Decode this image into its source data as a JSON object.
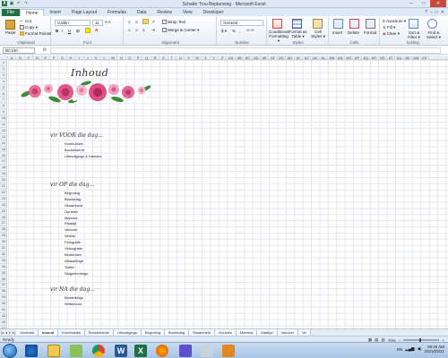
{
  "window": {
    "title": "Schatte Trou Beplanning  -  Microsoft Excel",
    "controls": [
      "–",
      "□",
      "✕"
    ]
  },
  "ribbon_tabs": {
    "file": "File",
    "tabs": [
      "Home",
      "Insert",
      "Page Layout",
      "Formulas",
      "Data",
      "Review",
      "View",
      "Developer"
    ]
  },
  "ribbon": {
    "clipboard": {
      "paste": "Paste",
      "cut": "Cut",
      "copy": "Copy ▾",
      "format_painter": "Format Painter",
      "group": "Clipboard"
    },
    "font": {
      "name": "Calibri",
      "size": "11",
      "bold": "B",
      "italic": "I",
      "underline": "U",
      "group": "Font"
    },
    "alignment": {
      "wrap": "Wrap Text",
      "merge": "Merge & Center ▾",
      "group": "Alignment"
    },
    "number": {
      "format": "General",
      "percent": "%",
      "comma": ",",
      "group": "Number"
    },
    "styles": {
      "conditional": "Conditional Formatting ▾",
      "format_table": "Format as Table ▾",
      "cell_styles": "Cell Styles ▾",
      "group": "Styles"
    },
    "cells": {
      "insert": "Insert",
      "delete": "Delete",
      "format": "Format",
      "group": "Cells"
    },
    "editing": {
      "autosum": "AutoSum ▾",
      "fill": "Fill ▾",
      "clear": "Clear ▾",
      "sort": "Sort & Filter ▾",
      "find": "Find & Select ▾",
      "group": "Editing"
    }
  },
  "formula_bar": {
    "name_box": "BC100",
    "fx": "fx",
    "value": ""
  },
  "columns": [
    "A",
    "B",
    "C",
    "D",
    "E",
    "F",
    "G",
    "H",
    "I",
    "J",
    "K",
    "L",
    "M",
    "N",
    "O",
    "P",
    "Q",
    "R",
    "S",
    "T",
    "U",
    "V",
    "W",
    "X",
    "Y",
    "Z",
    "AA",
    "AB",
    "AC",
    "AD",
    "AE",
    "AF",
    "AG",
    "AH",
    "AI",
    "AJ",
    "AK",
    "AL",
    "AM",
    "AN",
    "AO",
    "AP",
    "AQ",
    "AR",
    "AS",
    "AT",
    "AU",
    "AV",
    "AW",
    "AX"
  ],
  "sheet": {
    "title": "Inhoud",
    "sections": [
      {
        "heading": "vir VOOR die dag...",
        "items": [
          "Kombuisies",
          "Bucketwerre",
          "Uitnodigings & Dankies"
        ]
      },
      {
        "heading": "vir OP die dag...",
        "items": [
          "Begroting",
          "Bruidsdag",
          "Skaamheid",
          "Gunstes",
          "Mamma",
          "Plaaitjd",
          "Vanover",
          "Verklik",
          "Fotografie",
          "Videografie",
          "Bediendes",
          "Afhaaldinge",
          "Tuiflet",
          "Salgeleentings"
        ]
      },
      {
        "heading": "vir NA die dag...",
        "items": [
          "Bedankings",
          "Wittebrood"
        ]
      }
    ]
  },
  "sheet_tabs": [
    "Voorblad",
    "Inhoud",
    "Kombuisies",
    "Bucketwerke",
    "Uitnodigings",
    "Begroting",
    "Bruidsdag",
    "Skaamheid",
    "Gunstes",
    "Mamma",
    "Madfyd",
    "Vanover",
    "Ve"
  ],
  "active_sheet": "Inhoud",
  "status": {
    "ready": "Ready",
    "zoom": "70%"
  },
  "taskbar": {
    "language": "EN",
    "time": "09:46 AM",
    "date": "2021/02/21"
  },
  "colors": {
    "excel_green": "#1e7145",
    "ribbon_bg": "#dfe9f5",
    "rose": "#e25a8a"
  }
}
